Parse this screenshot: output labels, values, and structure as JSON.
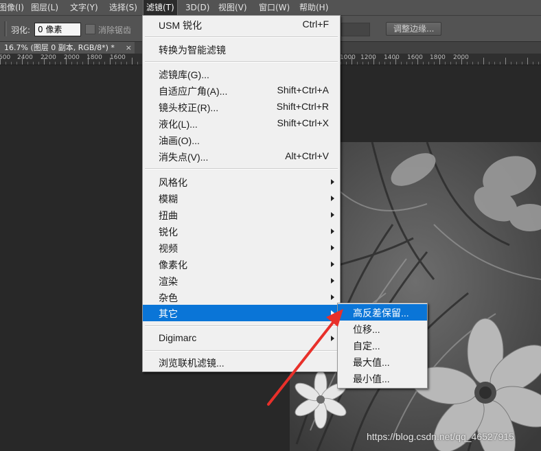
{
  "menubar": {
    "items": [
      {
        "label": "图像(I)"
      },
      {
        "label": "图层(L)"
      },
      {
        "label": "文字(Y)"
      },
      {
        "label": "选择(S)"
      },
      {
        "label": "滤镜(T)",
        "active": true
      },
      {
        "label": "3D(D)"
      },
      {
        "label": "视图(V)"
      },
      {
        "label": "窗口(W)"
      },
      {
        "label": "帮助(H)"
      }
    ]
  },
  "options_bar": {
    "feather_label": "羽化:",
    "feather_value": "0 像素",
    "antialias_label": "消除锯齿",
    "refine_edge_button": "调整边缘..."
  },
  "document": {
    "tab_title": "16.7% (图层 0 副本, RGB/8*) *",
    "close_glyph": "×"
  },
  "ruler": {
    "labels": [
      "600",
      "2400",
      "2200",
      "2000",
      "1800",
      "1600",
      "1000",
      "1200",
      "1400",
      "1600",
      "1800",
      "2000"
    ]
  },
  "filter_menu": {
    "items": [
      {
        "label": "USM 锐化",
        "shortcut": "Ctrl+F"
      },
      {
        "label": "转换为智能滤镜"
      },
      {
        "label": "滤镜库(G)..."
      },
      {
        "label": "自适应广角(A)...",
        "shortcut": "Shift+Ctrl+A"
      },
      {
        "label": "镜头校正(R)...",
        "shortcut": "Shift+Ctrl+R"
      },
      {
        "label": "液化(L)...",
        "shortcut": "Shift+Ctrl+X"
      },
      {
        "label": "油画(O)..."
      },
      {
        "label": "消失点(V)...",
        "shortcut": "Alt+Ctrl+V"
      },
      {
        "label": "风格化"
      },
      {
        "label": "模糊"
      },
      {
        "label": "扭曲"
      },
      {
        "label": "锐化"
      },
      {
        "label": "视频"
      },
      {
        "label": "像素化"
      },
      {
        "label": "渲染"
      },
      {
        "label": "杂色"
      },
      {
        "label": "其它",
        "highlighted": true
      },
      {
        "label": "Digimarc"
      },
      {
        "label": "浏览联机滤镜..."
      }
    ]
  },
  "other_submenu": {
    "items": [
      {
        "label": "高反差保留...",
        "highlighted": true
      },
      {
        "label": "位移..."
      },
      {
        "label": "自定..."
      },
      {
        "label": "最大值..."
      },
      {
        "label": "最小值..."
      }
    ]
  },
  "watermark": "https://blog.csdn.net/qq_46527915",
  "colors": {
    "highlight": "#0a75d7",
    "annotation_arrow": "#e8302a"
  }
}
